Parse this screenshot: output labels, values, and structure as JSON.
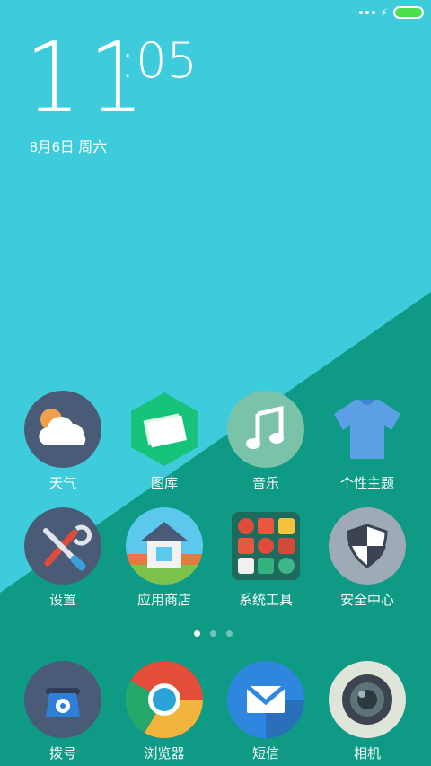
{
  "status_bar": {
    "icons": [
      "signal-dots-icon",
      "charging-icon",
      "battery-icon"
    ]
  },
  "clock": {
    "hours": "11",
    "minutes": ":05"
  },
  "date": "8月6日 周六",
  "apps_row1": [
    {
      "label": "天气",
      "icon": "weather-icon"
    },
    {
      "label": "图库",
      "icon": "gallery-icon"
    },
    {
      "label": "音乐",
      "icon": "music-icon"
    },
    {
      "label": "个性主题",
      "icon": "themes-icon"
    }
  ],
  "apps_row2": [
    {
      "label": "设置",
      "icon": "settings-icon"
    },
    {
      "label": "应用商店",
      "icon": "app-store-icon"
    },
    {
      "label": "系统工具",
      "icon": "system-tools-folder-icon"
    },
    {
      "label": "安全中心",
      "icon": "security-icon"
    }
  ],
  "page_indicator": {
    "count": 3,
    "active": 1
  },
  "dock": [
    {
      "label": "拨号",
      "icon": "phone-icon"
    },
    {
      "label": "浏览器",
      "icon": "browser-icon"
    },
    {
      "label": "短信",
      "icon": "messages-icon"
    },
    {
      "label": "相机",
      "icon": "camera-icon"
    }
  ],
  "colors": {
    "sky": "#3ecbdb",
    "teal": "#0f9a86"
  }
}
